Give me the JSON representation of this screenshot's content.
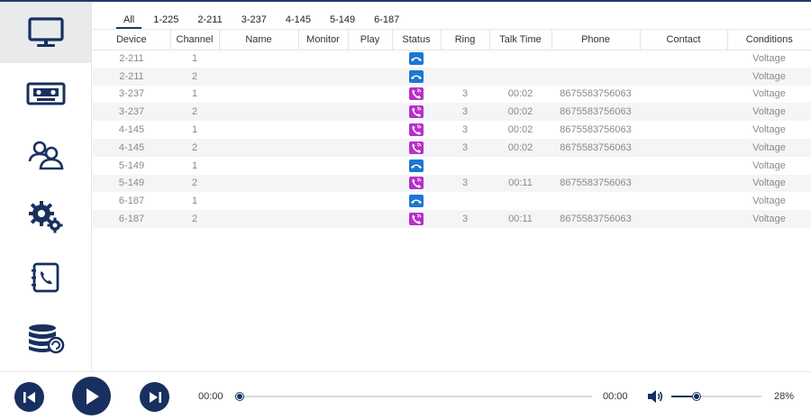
{
  "tabs": [
    "All",
    "1-225",
    "2-211",
    "3-237",
    "4-145",
    "5-149",
    "6-187"
  ],
  "sidebar": [
    {
      "icon": "monitor-icon",
      "active": true
    },
    {
      "icon": "cassette-recording-icon",
      "active": false
    },
    {
      "icon": "contacts-users-icon",
      "active": false
    },
    {
      "icon": "gears-settings-icon",
      "active": false
    },
    {
      "icon": "phonebook-icon",
      "active": false
    },
    {
      "icon": "database-icon",
      "active": false
    }
  ],
  "columns": [
    "Device",
    "Channel",
    "Name",
    "Monitor",
    "Play",
    "Status",
    "Ring",
    "Talk Time",
    "Phone",
    "Contact",
    "Conditions"
  ],
  "rows": [
    {
      "device": "2-211",
      "channel": "1",
      "name": "",
      "monitor": "",
      "play": "",
      "status": "idle",
      "ring": "",
      "talk_time": "",
      "phone": "",
      "contact": "",
      "conditions": "Voltage"
    },
    {
      "device": "2-211",
      "channel": "2",
      "name": "",
      "monitor": "",
      "play": "",
      "status": "idle",
      "ring": "",
      "talk_time": "",
      "phone": "",
      "contact": "",
      "conditions": "Voltage"
    },
    {
      "device": "3-237",
      "channel": "1",
      "name": "",
      "monitor": "",
      "play": "",
      "status": "call",
      "ring": "3",
      "talk_time": "00:02",
      "phone": "8675583756063",
      "contact": "",
      "conditions": "Voltage"
    },
    {
      "device": "3-237",
      "channel": "2",
      "name": "",
      "monitor": "",
      "play": "",
      "status": "call",
      "ring": "3",
      "talk_time": "00:02",
      "phone": "8675583756063",
      "contact": "",
      "conditions": "Voltage"
    },
    {
      "device": "4-145",
      "channel": "1",
      "name": "",
      "monitor": "",
      "play": "",
      "status": "call",
      "ring": "3",
      "talk_time": "00:02",
      "phone": "8675583756063",
      "contact": "",
      "conditions": "Voltage"
    },
    {
      "device": "4-145",
      "channel": "2",
      "name": "",
      "monitor": "",
      "play": "",
      "status": "call",
      "ring": "3",
      "talk_time": "00:02",
      "phone": "8675583756063",
      "contact": "",
      "conditions": "Voltage"
    },
    {
      "device": "5-149",
      "channel": "1",
      "name": "",
      "monitor": "",
      "play": "",
      "status": "idle",
      "ring": "",
      "talk_time": "",
      "phone": "",
      "contact": "",
      "conditions": "Voltage"
    },
    {
      "device": "5-149",
      "channel": "2",
      "name": "",
      "monitor": "",
      "play": "",
      "status": "call",
      "ring": "3",
      "talk_time": "00:11",
      "phone": "8675583756063",
      "contact": "",
      "conditions": "Voltage"
    },
    {
      "device": "6-187",
      "channel": "1",
      "name": "",
      "monitor": "",
      "play": "",
      "status": "idle",
      "ring": "",
      "talk_time": "",
      "phone": "",
      "contact": "",
      "conditions": "Voltage"
    },
    {
      "device": "6-187",
      "channel": "2",
      "name": "",
      "monitor": "",
      "play": "",
      "status": "call",
      "ring": "3",
      "talk_time": "00:11",
      "phone": "8675583756063",
      "contact": "",
      "conditions": "Voltage"
    }
  ],
  "status_colors": {
    "idle": "#1c77d2",
    "call": "#b82fc9"
  },
  "player": {
    "time_current": "00:00",
    "time_total": "00:00",
    "volume_label": "28%",
    "progress_fraction": 0.0,
    "volume_fraction": 0.28
  },
  "accent_color": "#17305f"
}
